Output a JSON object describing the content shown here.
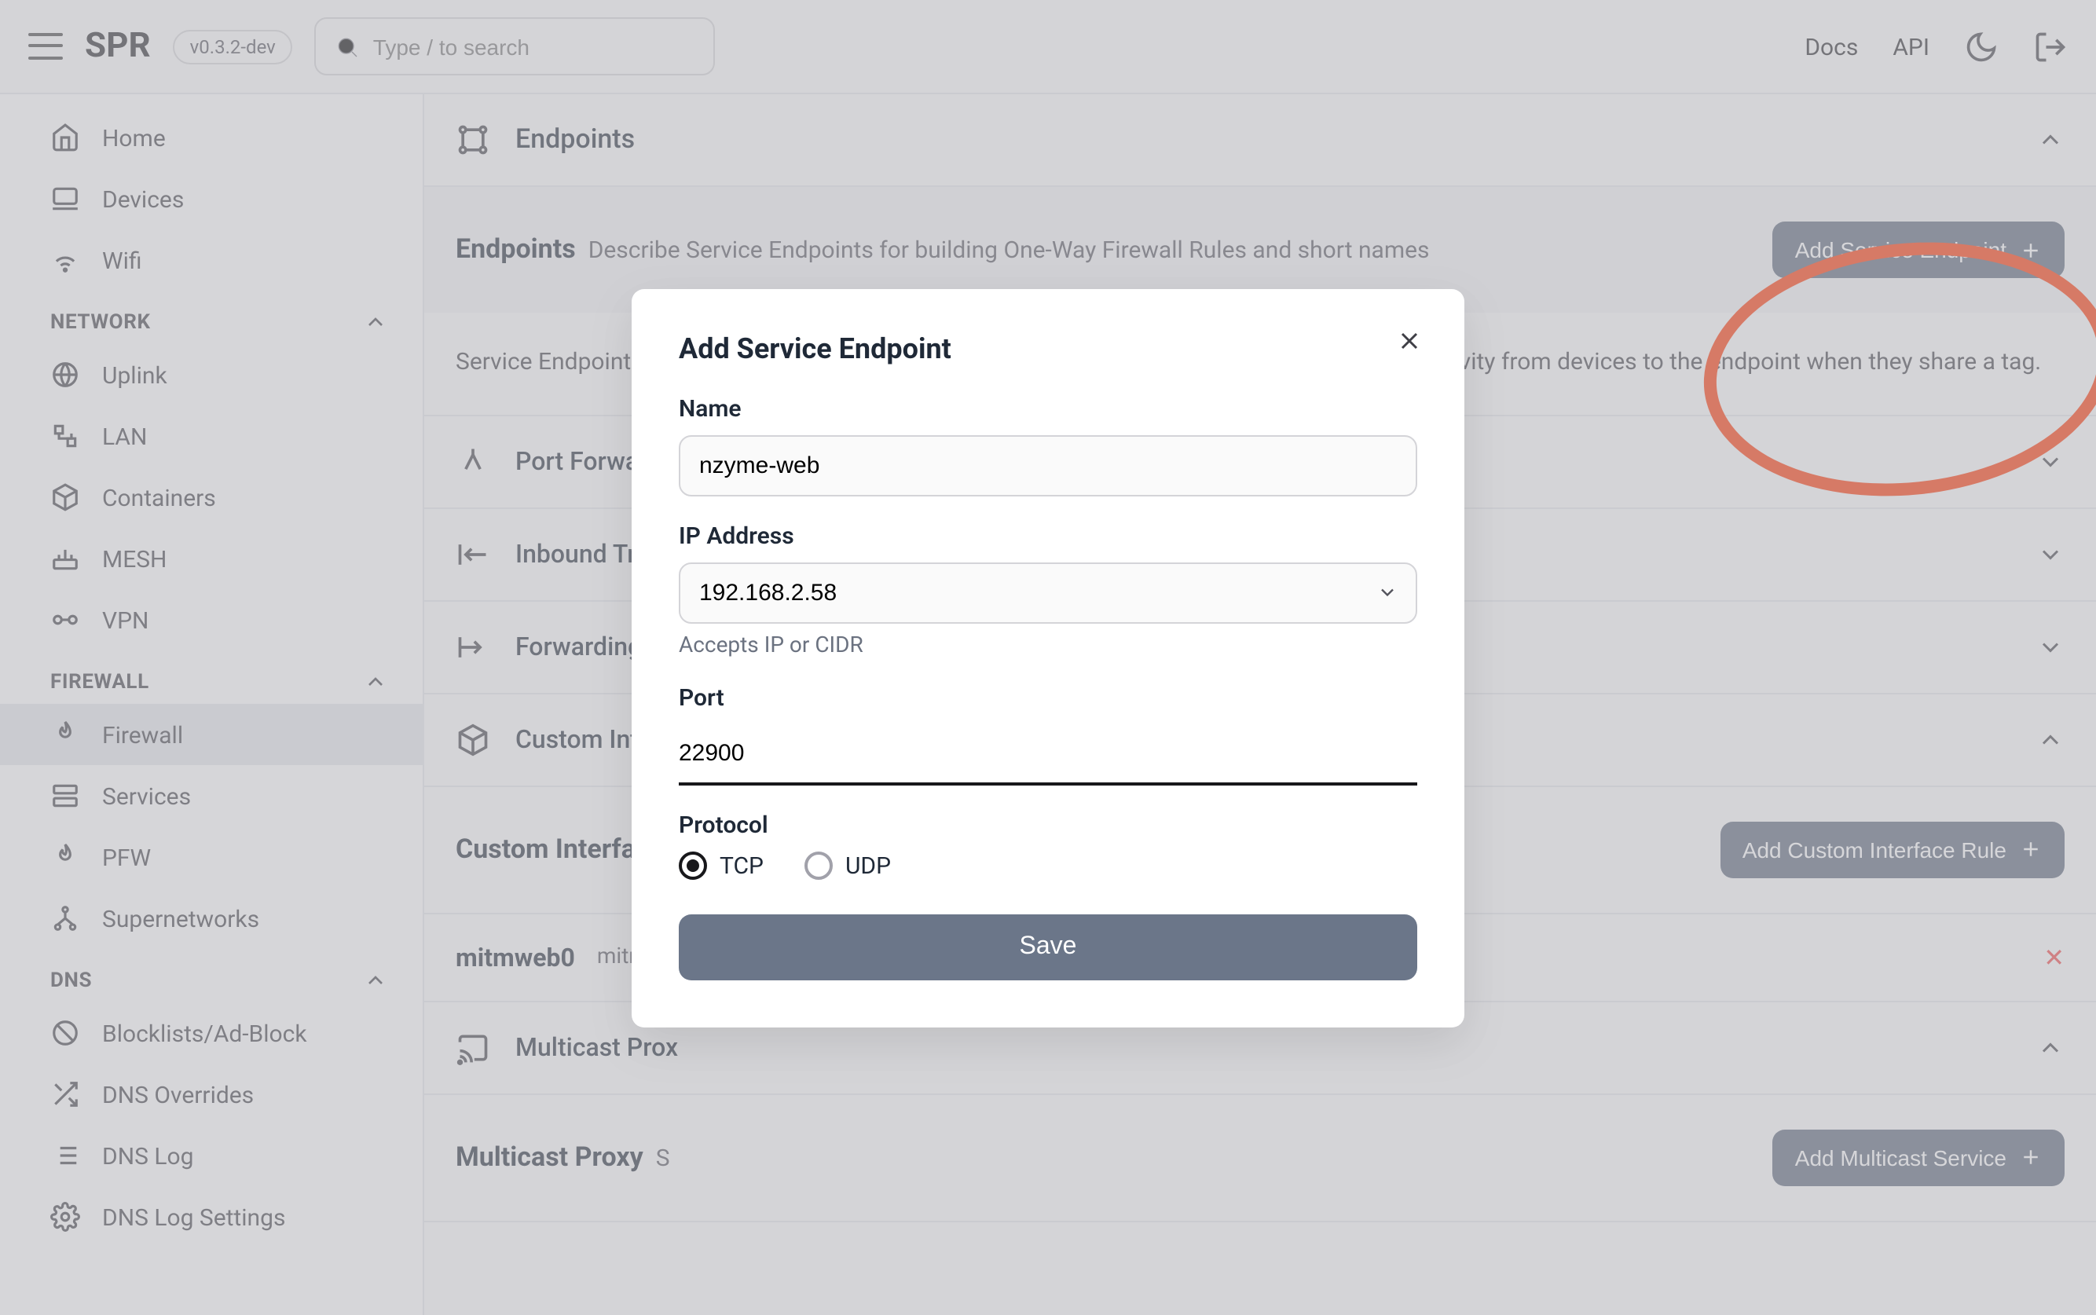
{
  "header": {
    "brand": "SPR",
    "version": "v0.3.2-dev",
    "search_placeholder": "Type / to search",
    "links": {
      "docs": "Docs",
      "api": "API"
    }
  },
  "sidebar": {
    "top": [
      {
        "label": "Home"
      },
      {
        "label": "Devices"
      },
      {
        "label": "Wifi"
      }
    ],
    "sections": [
      {
        "title": "NETWORK",
        "items": [
          {
            "label": "Uplink"
          },
          {
            "label": "LAN"
          },
          {
            "label": "Containers"
          },
          {
            "label": "MESH"
          },
          {
            "label": "VPN"
          }
        ]
      },
      {
        "title": "FIREWALL",
        "items": [
          {
            "label": "Firewall",
            "active": true
          },
          {
            "label": "Services"
          },
          {
            "label": "PFW"
          },
          {
            "label": "Supernetworks"
          }
        ]
      },
      {
        "title": "DNS",
        "items": [
          {
            "label": "Blocklists/Ad-Block"
          },
          {
            "label": "DNS Overrides"
          },
          {
            "label": "DNS Log"
          },
          {
            "label": "DNS Log Settings"
          }
        ]
      }
    ]
  },
  "main": {
    "endpoints": {
      "section_title": "Endpoints",
      "header_title": "Endpoints",
      "header_desc": "Describe Service Endpoints for building One-Way Firewall Rules and short names",
      "add_button": "Add Service Endpoint",
      "description": "Service Endpoints serves as helpers for creating other firewall rules, as well as one-way connectivity from devices to the endpoint when they share a tag."
    },
    "panels": [
      {
        "title": "Port Forwarding",
        "open": false
      },
      {
        "title": "Inbound Traffic Block",
        "open": false
      },
      {
        "title": "Forwarding Tr",
        "open": false
      },
      {
        "title": "Custom Interf",
        "open": true
      }
    ],
    "custom_interface": {
      "title": "Custom Interface",
      "add_button": "Add Custom Interface Rule",
      "rows": [
        {
          "name": "mitmweb0",
          "meta": "mitmw"
        }
      ]
    },
    "multicast_proxy_panel": "Multicast Prox",
    "multicast_proxy": {
      "title": "Multicast Proxy",
      "desc": "S",
      "add_button": "Add Multicast Service"
    }
  },
  "modal": {
    "title": "Add Service Endpoint",
    "name_label": "Name",
    "name_value": "nzyme-web",
    "ip_label": "IP Address",
    "ip_value": "192.168.2.58",
    "ip_hint": "Accepts IP or CIDR",
    "port_label": "Port",
    "port_value": "22900",
    "protocol_label": "Protocol",
    "protocol_options": {
      "tcp": "TCP",
      "udp": "UDP"
    },
    "protocol_selected": "tcp",
    "save": "Save"
  }
}
